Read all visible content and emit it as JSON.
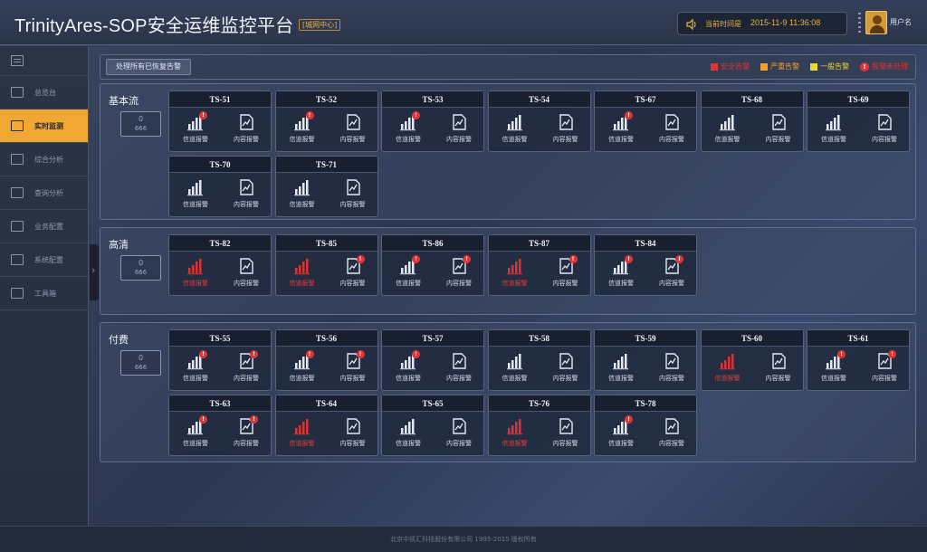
{
  "header": {
    "title": "TrinityAres-SOP安全运维监控平台",
    "org_tag": "[城网中心]",
    "time_label": "当前时间是",
    "time_value": "2015-11-9 11:36:08",
    "username": "用户名"
  },
  "sidebar": {
    "items": [
      {
        "label": "总览台",
        "icon": "monitor-icon",
        "active": false
      },
      {
        "label": "实时监测",
        "icon": "chart-icon",
        "active": true
      },
      {
        "label": "综合分析",
        "icon": "trend-icon",
        "active": false
      },
      {
        "label": "查询分析",
        "icon": "bars-icon",
        "active": false
      },
      {
        "label": "业务配置",
        "icon": "settings-icon",
        "active": false
      },
      {
        "label": "系统配置",
        "icon": "grid-icon",
        "active": false
      },
      {
        "label": "工具箱",
        "icon": "toolbox-icon",
        "active": false
      }
    ]
  },
  "toolbar": {
    "clear_label": "处理所有已恢复告警",
    "legend": [
      {
        "label": "安全告警",
        "color": "#e23434"
      },
      {
        "label": "严重告警",
        "color": "#f0a030"
      },
      {
        "label": "一般告警",
        "color": "#e8d83a"
      },
      {
        "label": "报警未处理",
        "color": "#e23434"
      }
    ]
  },
  "labels": {
    "channel": "信道报警",
    "content": "内容报警"
  },
  "groups": [
    {
      "name": "基本流",
      "counter": {
        "value": "0",
        "sub": "666"
      },
      "channels": [
        {
          "id": "TS-51",
          "ch": "badge",
          "ct": "none"
        },
        {
          "id": "TS-52",
          "ch": "badge",
          "ct": "none"
        },
        {
          "id": "TS-53",
          "ch": "badge",
          "ct": "none"
        },
        {
          "id": "TS-54",
          "ch": "none",
          "ct": "none"
        },
        {
          "id": "TS-67",
          "ch": "badge",
          "ct": "none"
        },
        {
          "id": "TS-68",
          "ch": "none",
          "ct": "none"
        },
        {
          "id": "TS-69",
          "ch": "none",
          "ct": "none"
        },
        {
          "id": "TS-70",
          "ch": "none",
          "ct": "none"
        },
        {
          "id": "TS-71",
          "ch": "none",
          "ct": "none"
        }
      ]
    },
    {
      "name": "高清",
      "counter": {
        "value": "0",
        "sub": "666"
      },
      "channels": [
        {
          "id": "TS-82",
          "ch": "red",
          "ct": "none"
        },
        {
          "id": "TS-85",
          "ch": "red",
          "ct": "badge"
        },
        {
          "id": "TS-86",
          "ch": "badge",
          "ct": "badge"
        },
        {
          "id": "TS-87",
          "ch": "red",
          "ct": "badge"
        },
        {
          "id": "TS-84",
          "ch": "badge",
          "ct": "badge"
        }
      ]
    },
    {
      "name": "付费",
      "counter": {
        "value": "0",
        "sub": "666"
      },
      "channels": [
        {
          "id": "TS-55",
          "ch": "badge",
          "ct": "badge"
        },
        {
          "id": "TS-56",
          "ch": "badge",
          "ct": "badge"
        },
        {
          "id": "TS-57",
          "ch": "badge",
          "ct": "none"
        },
        {
          "id": "TS-58",
          "ch": "none",
          "ct": "none"
        },
        {
          "id": "TS-59",
          "ch": "none",
          "ct": "none"
        },
        {
          "id": "TS-60",
          "ch": "red",
          "ct": "none"
        },
        {
          "id": "TS-61",
          "ch": "badge",
          "ct": "badge"
        },
        {
          "id": "TS-63",
          "ch": "badge",
          "ct": "badge"
        },
        {
          "id": "TS-64",
          "ch": "red",
          "ct": "none"
        },
        {
          "id": "TS-65",
          "ch": "none",
          "ct": "none"
        },
        {
          "id": "TS-76",
          "ch": "red",
          "ct": "none"
        },
        {
          "id": "TS-78",
          "ch": "badge",
          "ct": "none"
        }
      ]
    }
  ],
  "footer": {
    "text": "北京中凯汇科技股份有限公司 1995-2015 版权所有"
  }
}
